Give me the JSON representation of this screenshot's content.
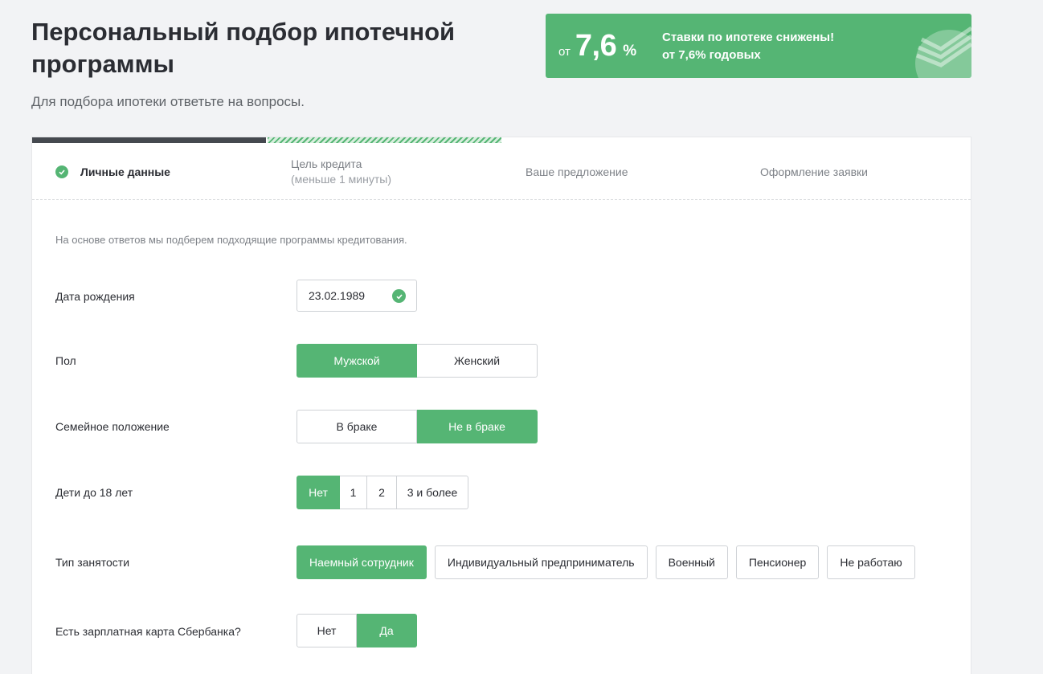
{
  "header": {
    "title": "Персональный подбор ипотечной программы",
    "subtitle": "Для подбора ипотеки ответьте на вопросы."
  },
  "promo": {
    "rate_prefix": "от",
    "rate_value": "7,6",
    "rate_unit": "%",
    "line1": "Ставки по ипотеке снижены!",
    "line2": "от 7,6% годовых",
    "color": "#55b574"
  },
  "progress": {
    "completed_steps": 1,
    "active_step": 2,
    "total_steps": 4
  },
  "steps": [
    {
      "label": "Личные данные",
      "status": "done"
    },
    {
      "label": "Цель кредита",
      "sub": "(меньше 1 минуты)",
      "status": "upcoming"
    },
    {
      "label": "Ваше предложение",
      "status": "upcoming"
    },
    {
      "label": "Оформление заявки",
      "status": "upcoming"
    }
  ],
  "form": {
    "intro": "На основе ответов мы подберем подходящие программы кредитования.",
    "birth_date": {
      "label": "Дата рождения",
      "value": "23.02.1989"
    },
    "gender": {
      "label": "Пол",
      "options": [
        "Мужской",
        "Женский"
      ],
      "selected": "Мужской"
    },
    "marital": {
      "label": "Семейное положение",
      "options": [
        "В браке",
        "Не в браке"
      ],
      "selected": "Не в браке"
    },
    "children": {
      "label": "Дети до 18 лет",
      "options": [
        "Нет",
        "1",
        "2",
        "3 и более"
      ],
      "selected": "Нет"
    },
    "employment": {
      "label": "Тип занятости",
      "options": [
        "Наемный сотрудник",
        "Индивидуальный предприниматель",
        "Военный",
        "Пенсионер",
        "Не работаю"
      ],
      "selected": "Наемный сотрудник"
    },
    "salary_card": {
      "label": "Есть зарплатная карта Сбербанка?",
      "options": [
        "Нет",
        "Да"
      ],
      "selected": "Да"
    }
  }
}
